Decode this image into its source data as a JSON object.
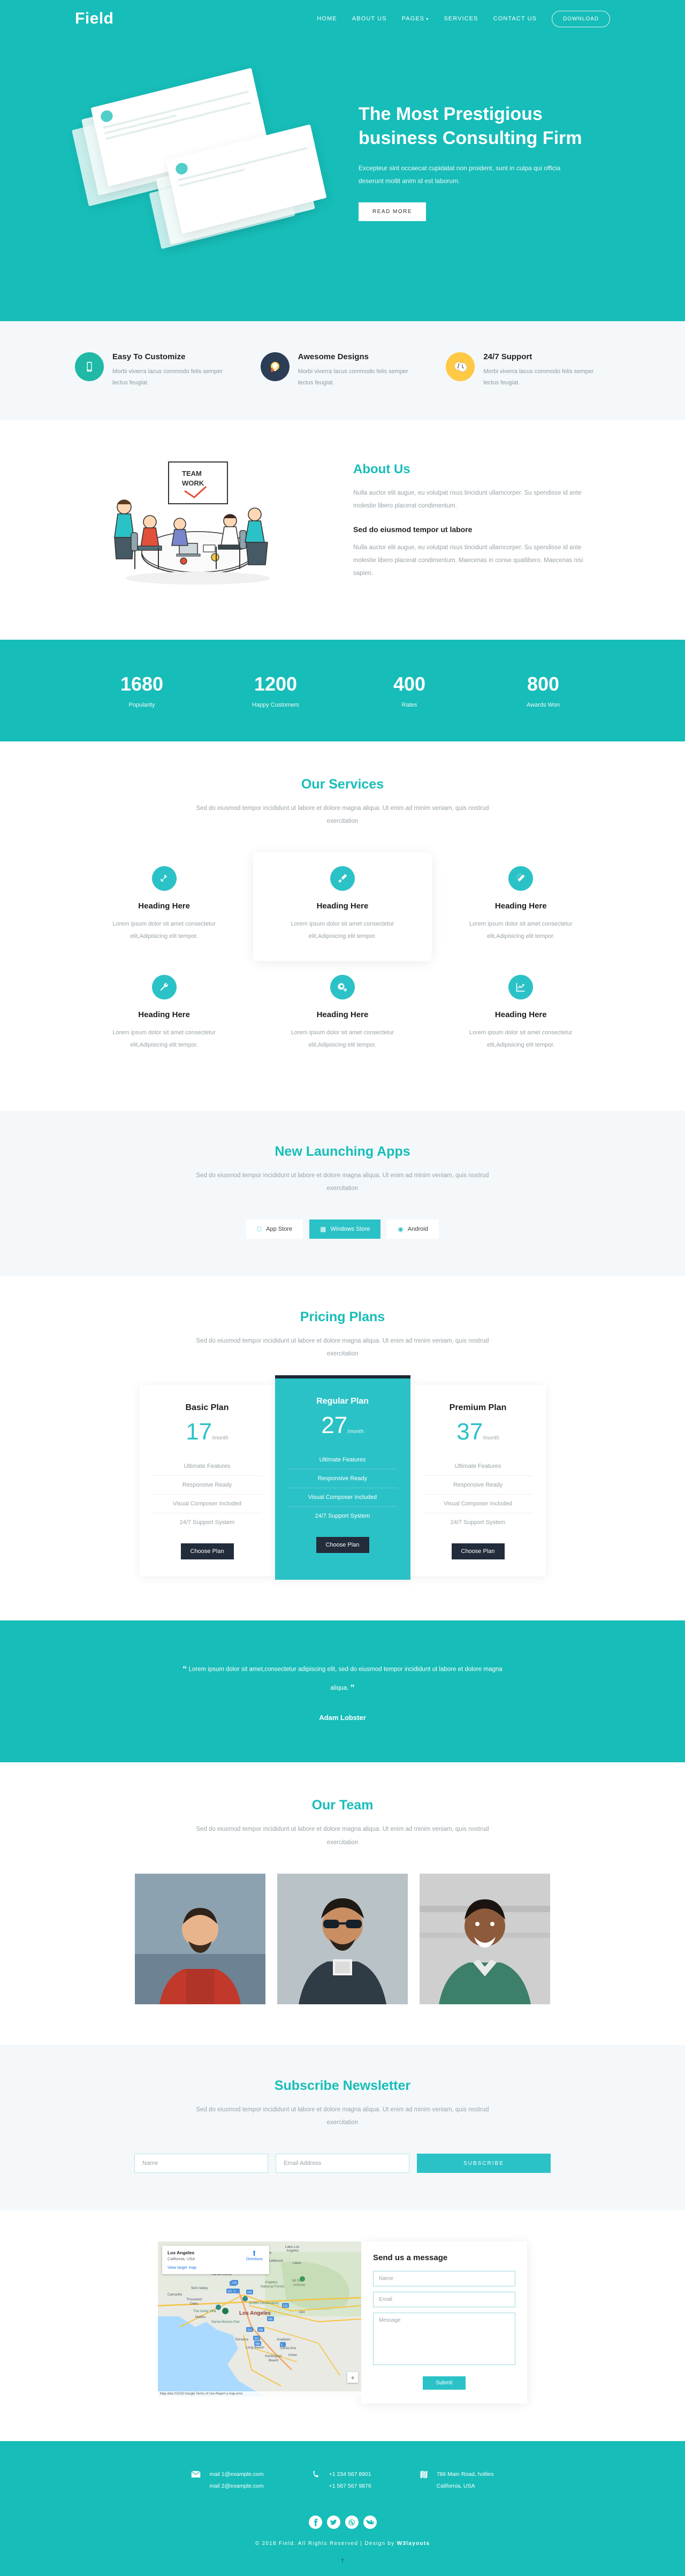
{
  "header": {
    "brand": "Field",
    "nav": [
      {
        "label": "HOME"
      },
      {
        "label": "ABOUT US"
      },
      {
        "label": "PAGES",
        "caret": "▾"
      },
      {
        "label": "SERVICES"
      },
      {
        "label": "CONTACT US"
      }
    ],
    "download_label": "DOWNLOAD"
  },
  "hero": {
    "title": "The Most Prestigious business Consulting Firm",
    "desc": "Excepteur sint occaecat cupidatat non proident, sunt in culpa qui officia deserunt mollit anim id est laborum.",
    "cta": "READ MORE"
  },
  "features": [
    {
      "icon": "mobile-icon",
      "title": "Easy To Customize",
      "desc": "Morbi viverra lacus commodo felis semper lectus feugiat."
    },
    {
      "icon": "lightbulb-icon",
      "title": "Awesome Designs",
      "desc": "Morbi viverra lacus commodo felis semper lectus feugiat."
    },
    {
      "icon": "clock-icon",
      "title": "24/7 Support",
      "desc": "Morbi viverra lacus commodo felis semper lectus feugiat."
    }
  ],
  "about": {
    "title": "About Us",
    "p1": "Nulla auctor elit augue, eu volutpat risus tincidunt ullamcorper. Su spendisse id ante molestie libero placerat condimentum.",
    "subtitle": "Sed do eiusmod tempor ut labore",
    "p2": "Nulla auctor elit augue, eu volutpat risus tincidunt ullamcorper. Su spendisse id ante molestie libero placerat condimentum. Maecenas in conse quatlibero. Maecenas nisi sapien.",
    "whiteboard_text": "TEAM WORK"
  },
  "counters": [
    {
      "num": "1680",
      "label": "Popularity"
    },
    {
      "num": "1200",
      "label": "Happy Customers"
    },
    {
      "num": "400",
      "label": "Rates"
    },
    {
      "num": "800",
      "label": "Awards Won"
    }
  ],
  "services": {
    "title": "Our Services",
    "desc": "Sed do eiusmod tempor incididunt ut labore et dolore magna aliqua. Ut enim ad minim veniam, quis nostrud exercitation",
    "items": [
      {
        "icon": "hammer-icon",
        "title": "Heading Here",
        "desc": "Lorem ipsum dolor sit amet consectetur elit,Adipisicing elit tempor.",
        "featured": false
      },
      {
        "icon": "paintbrush-icon",
        "title": "Heading Here",
        "desc": "Lorem ipsum dolor sit amet consectetur elit,Adipisicing elit tempor.",
        "featured": true
      },
      {
        "icon": "magic-wand-icon",
        "title": "Heading Here",
        "desc": "Lorem ipsum dolor sit amet consectetur elit,Adipisicing elit tempor.",
        "featured": false
      },
      {
        "icon": "wrench-icon",
        "title": "Heading Here",
        "desc": "Lorem ipsum dolor sit amet consectetur elit,Adipisicing elit tempor.",
        "featured": false
      },
      {
        "icon": "gears-icon",
        "title": "Heading Here",
        "desc": "Lorem ipsum dolor sit amet consectetur elit,Adipisicing elit tempor.",
        "featured": false
      },
      {
        "icon": "chart-line-icon",
        "title": "Heading Here",
        "desc": "Lorem ipsum dolor sit amet consectetur elit,Adipisicing elit tempor.",
        "featured": false
      }
    ]
  },
  "apps": {
    "title": "New Launching Apps",
    "desc": "Sed do eiusmod tempor incididunt ut labore et dolore magna aliqua. Ut enim ad minim veniam, quis nostrud exercitation",
    "buttons": [
      {
        "icon": "apple-icon",
        "label": "App Store",
        "active": false
      },
      {
        "icon": "windows-icon",
        "label": "Windows Store",
        "active": true
      },
      {
        "icon": "android-icon",
        "label": "Android",
        "active": false
      }
    ]
  },
  "pricing": {
    "title": "Pricing Plans",
    "desc": "Sed do eiusmod tempor incididunt ut labore et dolore magna aliqua. Ut enim ad minim veniam, quis nostrud exercitation",
    "per_label": "/month",
    "cta": "Choose Plan",
    "plans": [
      {
        "name": "Basic Plan",
        "price": "17",
        "featured": false,
        "features": [
          "Ultimate Features",
          "Responsive Ready",
          "Visual Composer Included",
          "24/7 Support System"
        ]
      },
      {
        "name": "Regular Plan",
        "price": "27",
        "featured": true,
        "features": [
          "Ultimate Features",
          "Responsive Ready",
          "Visual Composer Included",
          "24/7 Support System"
        ]
      },
      {
        "name": "Premium Plan",
        "price": "37",
        "featured": false,
        "features": [
          "Ultimate Features",
          "Responsive Ready",
          "Visual Composer Included",
          "24/7 Support System"
        ]
      }
    ]
  },
  "testimonial": {
    "quote_open": "“",
    "quote_close": "”",
    "text": "Lorem ipsum dolor sit amet,consectetur adipiscing elit, sed do eiusmod tempor incididunt ut labore et dolore magna aliqua.",
    "author": "Adam Lobster"
  },
  "team": {
    "title": "Our Team",
    "desc": "Sed do eiusmod tempor incididunt ut labore et dolore magna aliqua. Ut enim ad minim veniam, quis nostrud exercitation",
    "members": [
      {
        "photo": "man-red-sweater-photo"
      },
      {
        "photo": "man-sunglasses-photo"
      },
      {
        "photo": "man-smiling-photo"
      }
    ]
  },
  "newsletter": {
    "title": "Subscribe Newsletter",
    "desc": "Sed do eiusmod tempor incididunt ut labore et dolore magna aliqua. Ut enim ad minim veniam, quis nostrud exercitation",
    "name_placeholder": "Name",
    "email_placeholder": "Email Address",
    "subscribe_label": "SUBSCRIBE"
  },
  "contact": {
    "map": {
      "title": "Los Angeles",
      "subtitle": "California, USA",
      "link": "View larger map",
      "directions": "Directions",
      "zoom_in": "+",
      "attribution": "Map data ©2018 Google  Terms of Use  Report a map error",
      "labels": [
        "Palmdale",
        "Littlerock",
        "Llano",
        "Acton",
        "Lake Los Angeles",
        "Santa Clarita",
        "Simi Valley",
        "Camarillo",
        "Thousand Oaks",
        "Angeles National Forest",
        "Mt San Antonio",
        "Griffith Observatory",
        "The Getty Villa",
        "Malibu",
        "Santa Monica Pier",
        "Los Angeles",
        "Torrance",
        "Long Beach",
        "Huntington Beach",
        "Anaheim",
        "Santa Ana",
        "Irvine",
        "Ont"
      ]
    },
    "form": {
      "title": "Send us a message",
      "name_placeholder": "Name",
      "email_placeholder": "Email",
      "message_placeholder": "Message",
      "submit_label": "Submit"
    }
  },
  "footer": {
    "items": [
      {
        "icon": "envelope-icon",
        "line1": "mail 1@example.com",
        "line2": "mail 2@example.com"
      },
      {
        "icon": "phone-icon",
        "line1": "+1 234 567 8901",
        "line2": "+1 567 567 9876"
      },
      {
        "icon": "map-icon",
        "line1": "786 Main Road, hollies",
        "line2": "California, USA"
      }
    ],
    "socials": [
      {
        "name": "facebook-icon",
        "glyph": "f"
      },
      {
        "name": "twitter-icon",
        "glyph": "✉"
      },
      {
        "name": "dribbble-icon",
        "glyph": "●"
      },
      {
        "name": "vk-icon",
        "glyph": "vk"
      }
    ],
    "copyright": "© 2018 Field. All Rights Reserved | Design by ",
    "designer": "W3layouts",
    "to_top": "↑"
  }
}
